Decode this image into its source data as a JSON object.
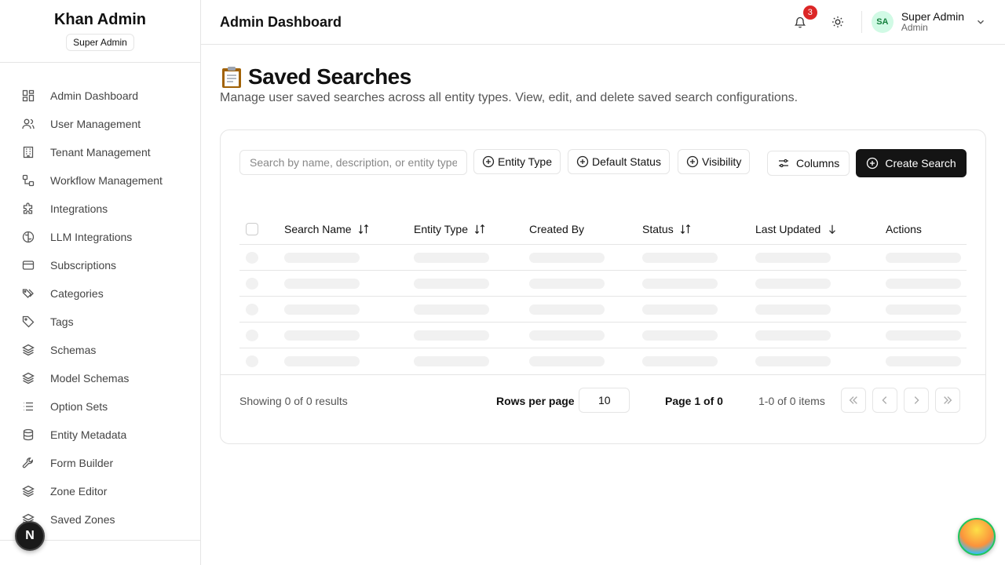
{
  "sidebar": {
    "brand": "Khan Admin",
    "badge": "Super Admin",
    "items": [
      {
        "label": "Admin Dashboard",
        "icon": "dashboard-icon"
      },
      {
        "label": "User Management",
        "icon": "users-icon"
      },
      {
        "label": "Tenant Management",
        "icon": "building-icon"
      },
      {
        "label": "Workflow Management",
        "icon": "workflow-icon"
      },
      {
        "label": "Integrations",
        "icon": "puzzle-icon"
      },
      {
        "label": "LLM Integrations",
        "icon": "brain-icon"
      },
      {
        "label": "Subscriptions",
        "icon": "credit-card-icon"
      },
      {
        "label": "Categories",
        "icon": "tags-icon"
      },
      {
        "label": "Tags",
        "icon": "tag-icon"
      },
      {
        "label": "Schemas",
        "icon": "layers-icon"
      },
      {
        "label": "Model Schemas",
        "icon": "layers-icon"
      },
      {
        "label": "Option Sets",
        "icon": "list-icon"
      },
      {
        "label": "Entity Metadata",
        "icon": "database-icon"
      },
      {
        "label": "Form Builder",
        "icon": "wrench-icon"
      },
      {
        "label": "Zone Editor",
        "icon": "layers-icon"
      },
      {
        "label": "Saved Zones",
        "icon": "layers-icon"
      }
    ]
  },
  "header": {
    "title": "Admin Dashboard",
    "notification_count": "3",
    "user": {
      "initials": "SA",
      "name": "Super Admin",
      "role": "Admin"
    }
  },
  "main": {
    "title": "Saved Searches",
    "description": "Manage user saved searches across all entity types. View, edit, and delete saved search configurations.",
    "search_placeholder": "Search by name, description, or entity type...",
    "filters": [
      "Entity Type",
      "Default Status",
      "Visibility"
    ],
    "columns_label": "Columns",
    "create_label": "Create Search",
    "table": {
      "headers": [
        "Search Name",
        "Entity Type",
        "Created By",
        "Status",
        "Last Updated",
        "Actions"
      ]
    },
    "footer": {
      "results": "Showing 0 of 0 results",
      "rows_label": "Rows per page",
      "rows_value": "10",
      "page": "Page 1 of 0",
      "items": "1-0 of 0 items"
    }
  },
  "colors": {
    "primary": "#141414",
    "badge": "#dc2626",
    "avatar_bg": "#d1fae5"
  }
}
